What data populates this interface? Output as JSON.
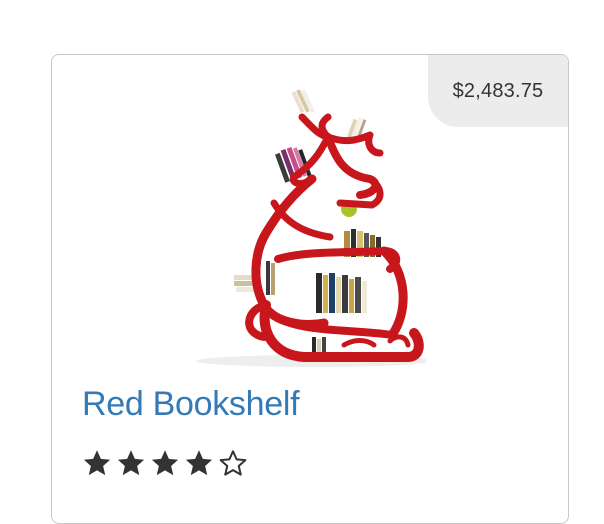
{
  "product": {
    "price": "$2,483.75",
    "title": "Red Bookshelf",
    "image_icon": "red-bookshelf-image",
    "rating": {
      "value": 4,
      "max": 5
    },
    "description": "",
    "accent_color": "#337ab7",
    "shelf_color": "#c8161d"
  }
}
